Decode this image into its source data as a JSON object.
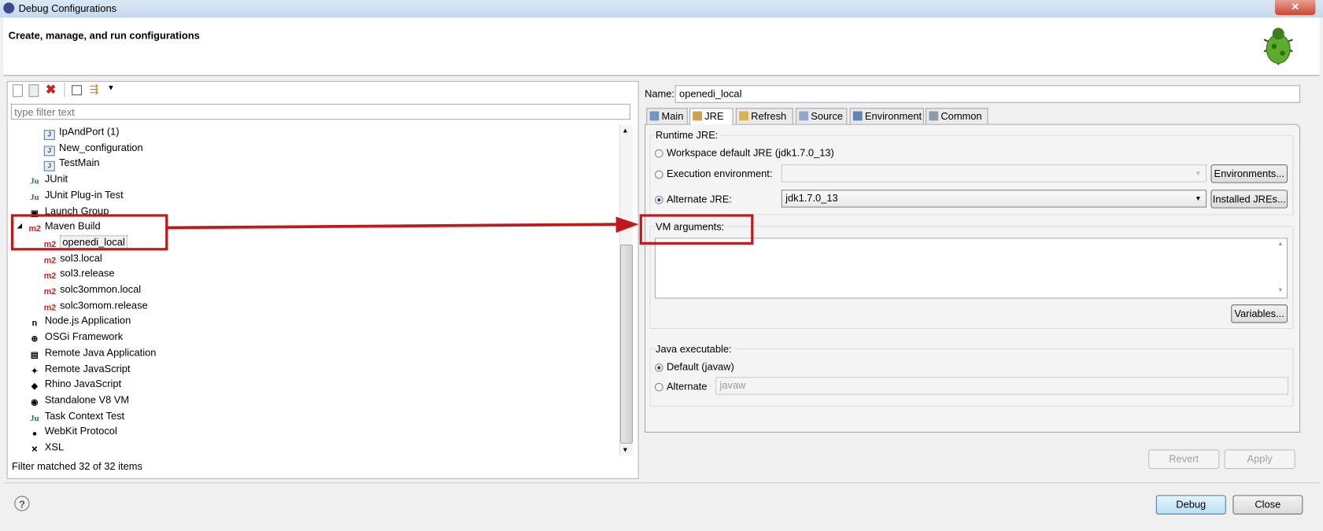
{
  "window": {
    "title": "Debug Configurations",
    "close": "✕"
  },
  "header": {
    "subtitle": "Create, manage, and run configurations"
  },
  "toolbar": {
    "icons": [
      "new-config-icon",
      "duplicate-icon",
      "delete-icon",
      "collapse-all-icon",
      "filter-icon",
      "dropdown-icon"
    ]
  },
  "filter": {
    "placeholder": "type filter text"
  },
  "tree": [
    {
      "label": "IpAndPort (1)",
      "icon": "J",
      "indent": 2
    },
    {
      "label": "New_configuration",
      "icon": "J",
      "indent": 2
    },
    {
      "label": "TestMain",
      "icon": "J",
      "indent": 2
    },
    {
      "label": "JUnit",
      "icon": "Ju",
      "indent": 1
    },
    {
      "label": "JUnit Plug-in Test",
      "icon": "Ju",
      "indent": 1
    },
    {
      "label": "Launch Group",
      "icon": "▣",
      "indent": 1
    },
    {
      "label": "Maven Build",
      "icon": "m2",
      "indent": 1,
      "expanded": true
    },
    {
      "label": "openedi_local",
      "icon": "m2",
      "indent": 2,
      "selected": true
    },
    {
      "label": "sol3.local",
      "icon": "m2",
      "indent": 2
    },
    {
      "label": "sol3.release",
      "icon": "m2",
      "indent": 2
    },
    {
      "label": "solc3ommon.local",
      "icon": "m2",
      "indent": 2
    },
    {
      "label": "solc3omom.release",
      "icon": "m2",
      "indent": 2
    },
    {
      "label": "Node.js Application",
      "icon": "n",
      "indent": 1
    },
    {
      "label": "OSGi Framework",
      "icon": "⊕",
      "indent": 1
    },
    {
      "label": "Remote Java Application",
      "icon": "▤",
      "indent": 1
    },
    {
      "label": "Remote JavaScript",
      "icon": "✦",
      "indent": 1
    },
    {
      "label": "Rhino JavaScript",
      "icon": "◆",
      "indent": 1
    },
    {
      "label": "Standalone V8 VM",
      "icon": "◉",
      "indent": 1
    },
    {
      "label": "Task Context Test",
      "icon": "Ju",
      "indent": 1
    },
    {
      "label": "WebKit Protocol",
      "icon": "●",
      "indent": 1
    },
    {
      "label": "XSL",
      "icon": "✕",
      "indent": 1
    }
  ],
  "status": "Filter matched 32 of 32 items",
  "config": {
    "name_label": "Name:",
    "name_value": "openedi_local",
    "tabs": [
      "Main",
      "JRE",
      "Refresh",
      "Source",
      "Environment",
      "Common"
    ],
    "active_tab": "JRE",
    "runtime_jre_label": "Runtime JRE:",
    "workspace_default": "Workspace default JRE (jdk1.7.0_13)",
    "execution_env": "Execution environment:",
    "execution_env_value": "",
    "environments_btn": "Environments...",
    "alternate_jre": "Alternate JRE:",
    "alternate_jre_value": "jdk1.7.0_13",
    "installed_jres_btn": "Installed JREs...",
    "vm_args_label": "VM arguments:",
    "vm_args_value": "",
    "variables_btn": "Variables...",
    "java_exec_label": "Java executable:",
    "default_javaw": "Default (javaw)",
    "alternate": "Alternate",
    "alternate_placeholder": "javaw",
    "revert": "Revert",
    "apply": "Apply"
  },
  "footer": {
    "help": "?",
    "debug": "Debug",
    "close": "Close"
  },
  "colors": {
    "annotation": "#c0181b",
    "m2": "#d32020"
  }
}
